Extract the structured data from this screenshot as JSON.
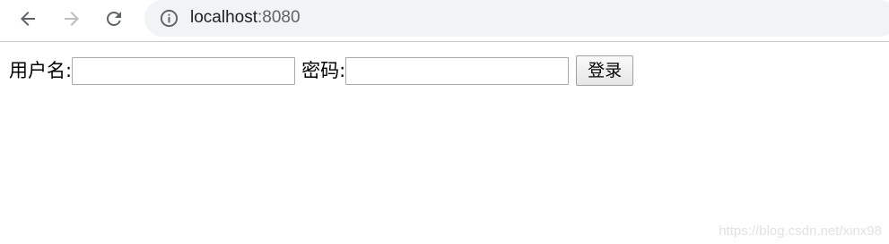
{
  "browser": {
    "url_host": "localhost",
    "url_port": ":8080",
    "icons": {
      "back": "arrow-left-icon",
      "forward": "arrow-right-icon",
      "reload": "reload-icon",
      "info": "info-icon"
    },
    "colors": {
      "toolbar_bg": "#ffffff",
      "omnibox_bg": "#f1f3f4",
      "icon_active": "#5f6368",
      "icon_disabled": "#bdbdbd"
    }
  },
  "form": {
    "username_label": "用户名:",
    "username_value": "",
    "password_label": "密码:",
    "password_value": "",
    "login_button_label": "登录"
  },
  "watermark": {
    "text": "https://blog.csdn.net/xinx98"
  }
}
